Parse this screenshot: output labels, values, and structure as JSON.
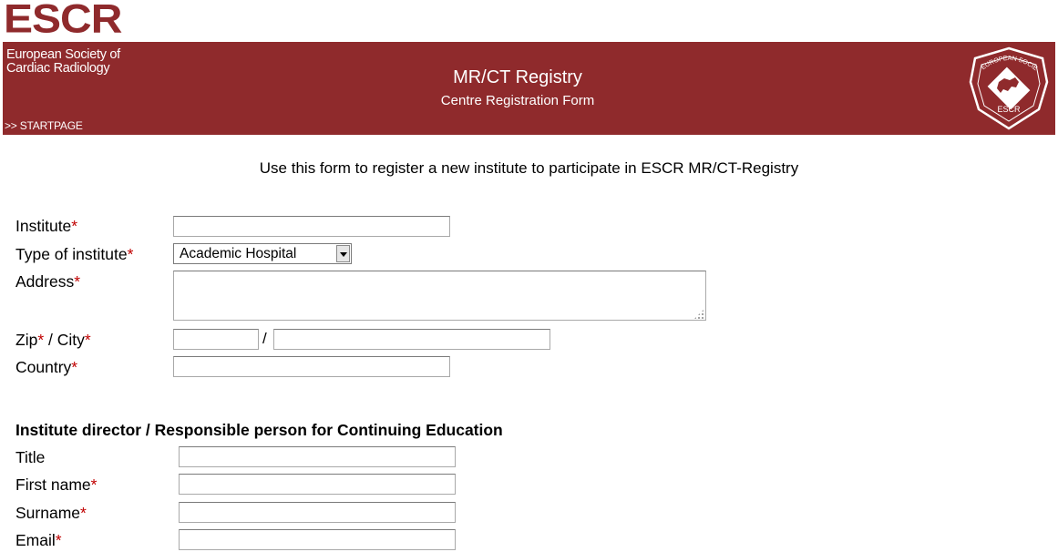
{
  "logo": {
    "text": "ESCR"
  },
  "banner": {
    "society_line1": "European Society of",
    "society_line2": "Cardiac Radiology",
    "startpage_link": ">> STARTPAGE",
    "title": "MR/CT Registry",
    "subtitle": "Centre Registration Form",
    "seal_text": "ESCR",
    "seal_ring_text": "EUROPEAN SOCIETY OF CARDIAC RADIOLOGY",
    "color": "#8f2a2c"
  },
  "intro": "Use this form to register a new institute to participate in ESCR MR/CT-Registry",
  "required_marker": "*",
  "form": {
    "institute_label": "Institute",
    "type_label": "Type of institute",
    "type_selected": "Academic Hospital",
    "address_label": "Address",
    "zip_label": "Zip",
    "city_sep": " / ",
    "city_label": "City",
    "zip_city_slash": "/",
    "country_label": "Country"
  },
  "director": {
    "heading": "Institute director / Responsible person for Continuing Education",
    "title_label": "Title",
    "first_name_label": "First name",
    "surname_label": "Surname",
    "email_label": "Email"
  },
  "colors": {
    "required": "#c00000",
    "accent": "#8f2a2c"
  }
}
